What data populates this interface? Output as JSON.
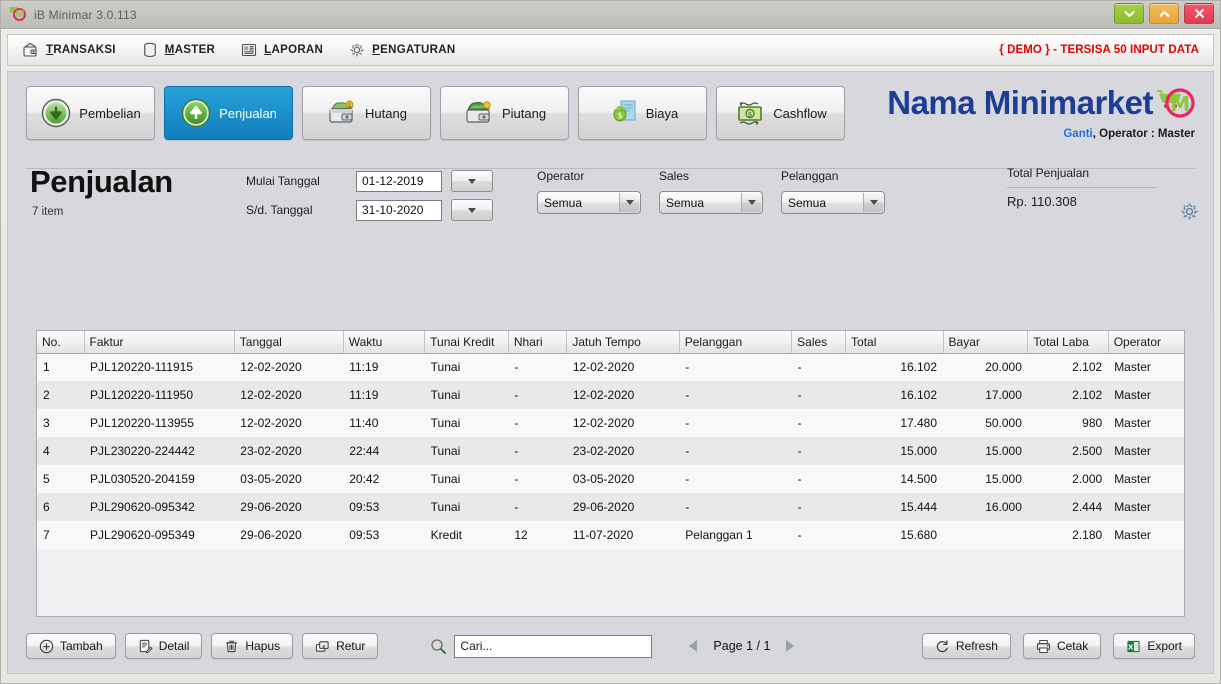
{
  "window": {
    "title": "iB Minimar 3.0.113",
    "logo_icon": "minimarket-logo-icon",
    "controls": [
      {
        "name": "minimize-button",
        "icon": "chevron-down-icon",
        "color": "#8dbc2e"
      },
      {
        "name": "maximize-button",
        "icon": "chevron-up-icon",
        "color": "#e8a63a"
      },
      {
        "name": "close-button",
        "icon": "close-icon",
        "color": "#e23a4e"
      }
    ]
  },
  "menubar": {
    "items": [
      {
        "label": "TRANSAKSI",
        "accel": "T",
        "icon": "wallet-icon"
      },
      {
        "label": "MASTER",
        "accel": "M",
        "icon": "database-icon"
      },
      {
        "label": "LAPORAN",
        "accel": "L",
        "icon": "report-icon"
      },
      {
        "label": "PENGATURAN",
        "accel": "P",
        "icon": "gear-icon"
      }
    ],
    "demo_notice": "{ DEMO } - TERSISA 50 INPUT DATA",
    "demo_color": "#e60000"
  },
  "tabs": [
    {
      "label": "Pembelian",
      "icon": "arrow-down-circle-icon",
      "active": false
    },
    {
      "label": "Penjualan",
      "icon": "arrow-up-circle-icon",
      "active": true
    },
    {
      "label": "Hutang",
      "icon": "wallet-money-icon",
      "active": false
    },
    {
      "label": "Piutang",
      "icon": "wallet-cash-icon",
      "active": false
    },
    {
      "label": "Biaya",
      "icon": "money-bag-icon",
      "active": false
    },
    {
      "label": "Cashflow",
      "icon": "cashflow-icon",
      "active": false
    }
  ],
  "brand": {
    "title": "Nama Minimarket",
    "logo_icon": "minimarket-logo-icon",
    "title_color": "#1d3c96",
    "change_link": "Ganti",
    "operator_text": ", Operator : Master"
  },
  "filters": {
    "page_title": "Penjualan",
    "item_count": "7 item",
    "start_label": "Mulai Tanggal",
    "start_value": "01-12-2019",
    "end_label": "S/d. Tanggal",
    "end_value": "31-10-2020",
    "operator_label": "Operator",
    "operator_value": "Semua",
    "sales_label": "Sales",
    "sales_value": "Semua",
    "pelanggan_label": "Pelanggan",
    "pelanggan_value": "Semua",
    "total_label": "Total Penjualan",
    "total_value": "Rp. 110.308",
    "settings_icon": "gear-icon"
  },
  "table": {
    "columns": [
      {
        "label": "No.",
        "width": "4.1%",
        "align": "left"
      },
      {
        "label": "Faktur",
        "width": "13.1%",
        "align": "left"
      },
      {
        "label": "Tanggal",
        "width": "9.5%",
        "align": "left"
      },
      {
        "label": "Waktu",
        "width": "7.1%",
        "align": "left"
      },
      {
        "label": "Tunai Kredit",
        "width": "7.3%",
        "align": "left"
      },
      {
        "label": "Nhari",
        "width": "5.1%",
        "align": "left"
      },
      {
        "label": "Jatuh Tempo",
        "width": "9.8%",
        "align": "left"
      },
      {
        "label": "Pelanggan",
        "width": "9.8%",
        "align": "left"
      },
      {
        "label": "Sales",
        "width": "4.7%",
        "align": "left"
      },
      {
        "label": "Total",
        "width": "8.5%",
        "align": "right"
      },
      {
        "label": "Bayar",
        "width": "7.4%",
        "align": "right"
      },
      {
        "label": "Total Laba",
        "width": "7.0%",
        "align": "right"
      },
      {
        "label": "Operator",
        "width": "6.6%",
        "align": "left"
      }
    ],
    "rows": [
      [
        "1",
        "PJL120220-111915",
        "12-02-2020",
        "11:19",
        "Tunai",
        "-",
        "12-02-2020",
        "-",
        "-",
        "16.102",
        "20.000",
        "2.102",
        "Master"
      ],
      [
        "2",
        "PJL120220-111950",
        "12-02-2020",
        "11:19",
        "Tunai",
        "-",
        "12-02-2020",
        "-",
        "-",
        "16.102",
        "17.000",
        "2.102",
        "Master"
      ],
      [
        "3",
        "PJL120220-113955",
        "12-02-2020",
        "11:40",
        "Tunai",
        "-",
        "12-02-2020",
        "-",
        "-",
        "17.480",
        "50.000",
        "980",
        "Master"
      ],
      [
        "4",
        "PJL230220-224442",
        "23-02-2020",
        "22:44",
        "Tunai",
        "-",
        "23-02-2020",
        "-",
        "-",
        "15.000",
        "15.000",
        "2.500",
        "Master"
      ],
      [
        "5",
        "PJL030520-204159",
        "03-05-2020",
        "20:42",
        "Tunai",
        "-",
        "03-05-2020",
        "-",
        "-",
        "14.500",
        "15.000",
        "2.000",
        "Master"
      ],
      [
        "6",
        "PJL290620-095342",
        "29-06-2020",
        "09:53",
        "Tunai",
        "-",
        "29-06-2020",
        "-",
        "-",
        "15.444",
        "16.000",
        "2.444",
        "Master"
      ],
      [
        "7",
        "PJL290620-095349",
        "29-06-2020",
        "09:53",
        "Kredit",
        "12",
        "11-07-2020",
        "Pelanggan 1",
        "-",
        "15.680",
        "",
        "2.180",
        "Master"
      ]
    ]
  },
  "bottombar": {
    "buttons_left": [
      {
        "label": "Tambah",
        "icon": "plus-circle-icon"
      },
      {
        "label": "Detail",
        "icon": "document-edit-icon"
      },
      {
        "label": "Hapus",
        "icon": "trash-icon"
      },
      {
        "label": "Retur",
        "icon": "return-icon"
      }
    ],
    "search_icon": "search-icon",
    "search_placeholder": "Cari...",
    "search_value": "",
    "page_prev_icon": "triangle-left-icon",
    "page_next_icon": "triangle-right-icon",
    "page_label": "Page 1 / 1",
    "buttons_right": [
      {
        "label": "Refresh",
        "icon": "refresh-icon"
      },
      {
        "label": "Cetak",
        "icon": "printer-icon"
      },
      {
        "label": "Export",
        "icon": "excel-icon"
      }
    ]
  }
}
